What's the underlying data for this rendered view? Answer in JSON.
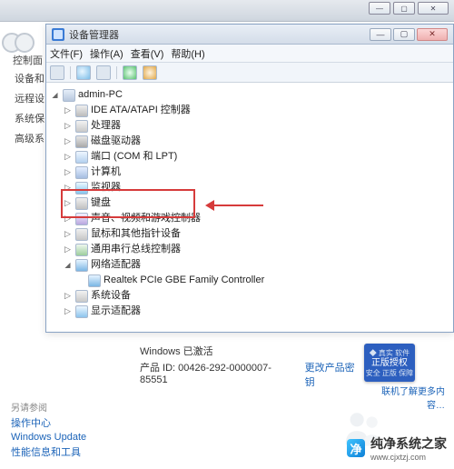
{
  "bg_window": {
    "btn_min": "—",
    "btn_max": "▢",
    "btn_close": "✕"
  },
  "left_nav": {
    "label_line": "控制面",
    "items": [
      "设备和",
      "远程设",
      "系统保",
      "高级系"
    ]
  },
  "device_mgr": {
    "title": "设备管理器",
    "btn_min": "—",
    "btn_max": "▢",
    "btn_close": "✕",
    "menu": {
      "file": "文件(F)",
      "action": "操作(A)",
      "view": "查看(V)",
      "help": "帮助(H)"
    },
    "root": "admin-PC",
    "categories": {
      "atapi": "IDE ATA/ATAPI 控制器",
      "cpu": "处理器",
      "disk": "磁盘驱动器",
      "com": "端口 (COM 和 LPT)",
      "computer": "计算机",
      "monitor": "监视器",
      "keyboard": "键盘",
      "sound": "声音、视频和游戏控制器",
      "mouse": "鼠标和其他指针设备",
      "usb": "通用串行总线控制器",
      "network": "网络适配器",
      "network_child": "Realtek PCIe GBE Family Controller",
      "system": "系统设备",
      "display": "显示适配器"
    }
  },
  "activation": {
    "status": "Windows 已激活",
    "pid_label": "产品 ID: 00426-292-0000007-85551",
    "change_key": "更改产品密钥",
    "badge_top": "◆ 真实 软件",
    "badge_main": "正版授权",
    "badge_sub": "安全 正版 保障",
    "more": "联机了解更多内容…"
  },
  "also": {
    "header": "另请参阅",
    "links": [
      "操作中心",
      "Windows Update",
      "性能信息和工具"
    ]
  },
  "watermark": {
    "name": "纯净系统之家",
    "url": "www.cjxtzj.com"
  }
}
